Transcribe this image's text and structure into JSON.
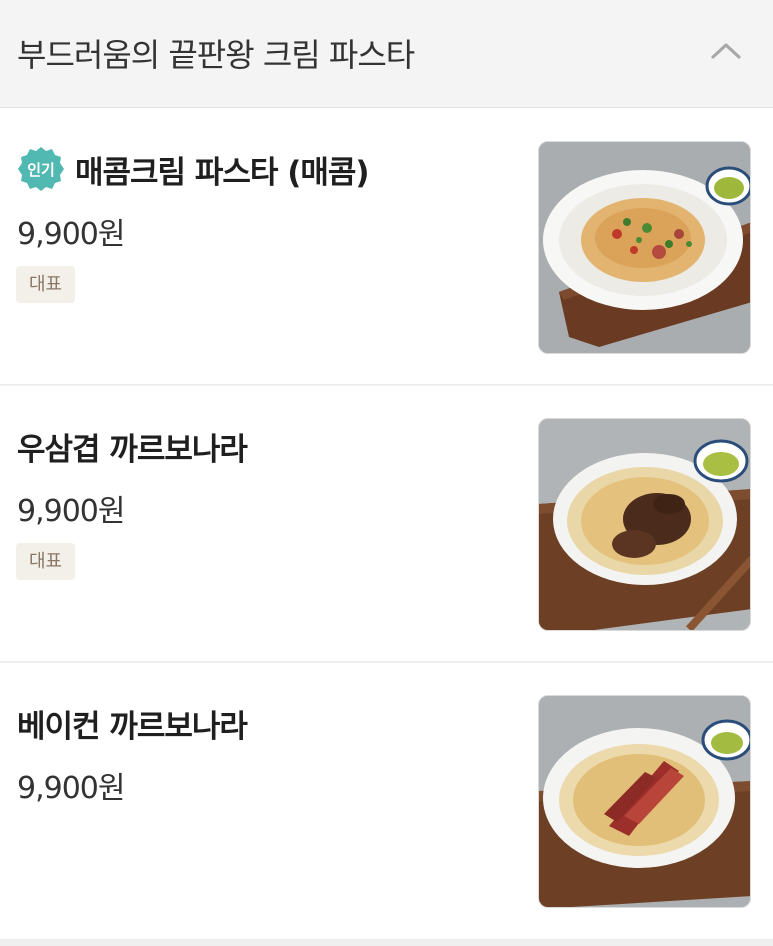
{
  "section": {
    "title": "부드러움의 끝판왕 크림 파스타"
  },
  "items": [
    {
      "popular_badge": "인기",
      "name": "매콤크림 파스타 (매콤)",
      "price": "9,900원",
      "tag": "대표",
      "photo_alt": "spicy-cream-pasta-photo"
    },
    {
      "name": "우삼겹 까르보나라",
      "price": "9,900원",
      "tag": "대표",
      "photo_alt": "beef-brisket-carbonara-photo"
    },
    {
      "name": "베이컨 까르보나라",
      "price": "9,900원",
      "photo_alt": "bacon-carbonara-photo"
    }
  ],
  "colors": {
    "header_bg": "#f4f4f4",
    "badge_teal": "#52b8b2",
    "tag_bg": "#f3efe9",
    "tag_text": "#8a7766"
  },
  "icons": {
    "collapse": "chevron-up-icon",
    "popular": "popular-badge-icon"
  }
}
